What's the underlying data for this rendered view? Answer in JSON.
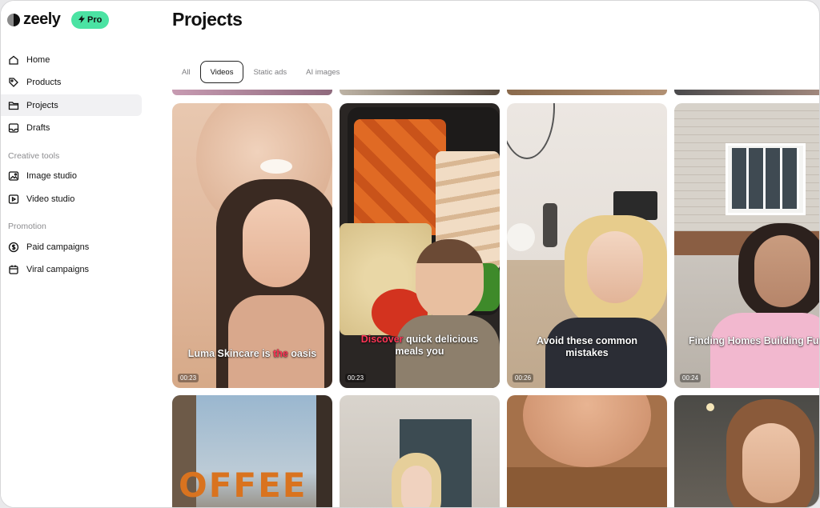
{
  "brand": {
    "name": "zeely",
    "badge": "Pro"
  },
  "sidebar": {
    "items": [
      {
        "label": "Home",
        "icon": "home-icon"
      },
      {
        "label": "Products",
        "icon": "tag-icon"
      },
      {
        "label": "Projects",
        "icon": "folder-icon",
        "active": true
      },
      {
        "label": "Drafts",
        "icon": "tray-icon"
      }
    ],
    "creative_label": "Creative tools",
    "creative_items": [
      {
        "label": "Image studio",
        "icon": "image-icon"
      },
      {
        "label": "Video studio",
        "icon": "video-icon"
      }
    ],
    "promotion_label": "Promotion",
    "promotion_items": [
      {
        "label": "Paid campaigns",
        "icon": "dollar-icon"
      },
      {
        "label": "Viral campaigns",
        "icon": "calendar-icon"
      }
    ]
  },
  "main": {
    "title": "Projects",
    "tabs": [
      {
        "label": "All"
      },
      {
        "label": "Videos",
        "active": true
      },
      {
        "label": "Static ads"
      },
      {
        "label": "AI images"
      }
    ]
  },
  "videos": [
    {
      "caption_pre": "Luma Skincare is ",
      "caption_hl": "the",
      "caption_post": " oasis",
      "duration": "00:23"
    },
    {
      "caption_pre": "",
      "caption_hl": "Discover",
      "caption_post": " quick delicious meals you",
      "duration": "00:23"
    },
    {
      "caption_pre": "Avoid these common mistakes",
      "caption_hl": "",
      "caption_post": "",
      "duration": "00:26"
    },
    {
      "caption_pre": "Finding Homes Building Futures is the",
      "caption_hl": "",
      "caption_post": "",
      "duration": "00:24"
    }
  ],
  "row2_text": {
    "cafe_sign": "OFFEE"
  },
  "colors": {
    "accent": "#4be3a3",
    "highlight": "#ff3656",
    "active_nav": "#f1f1f3"
  }
}
